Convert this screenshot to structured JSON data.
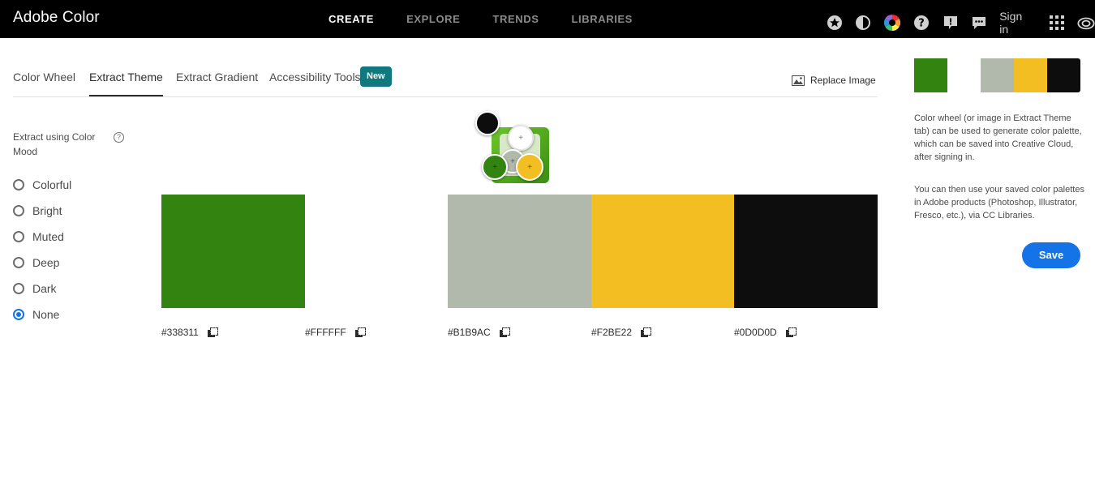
{
  "app": {
    "title": "Adobe Color"
  },
  "topnav": [
    "CREATE",
    "EXPLORE",
    "TRENDS",
    "LIBRARIES"
  ],
  "topnav_active": "CREATE",
  "header_icons": [
    "star-icon",
    "contrast-icon",
    "color-wheel-icon",
    "help-icon",
    "feedback-icon",
    "chat-icon"
  ],
  "signin_label": "Sign in",
  "tabs": [
    "Color Wheel",
    "Extract Theme",
    "Extract Gradient",
    "Accessibility Tools"
  ],
  "tabs_active": "Extract Theme",
  "new_badge": "New",
  "replace_image_label": "Replace Image",
  "mood": {
    "title": "Extract using Color Mood",
    "help": "?",
    "options": [
      "Colorful",
      "Bright",
      "Muted",
      "Deep",
      "Dark",
      "None"
    ],
    "selected": "None"
  },
  "swatches": [
    {
      "hex": "#338311",
      "color": "#338311"
    },
    {
      "hex": "#FFFFFF",
      "color": "#FFFFFF"
    },
    {
      "hex": "#B1B9AC",
      "color": "#B1B9AC"
    },
    {
      "hex": "#F2BE22",
      "color": "#F2BE22"
    },
    {
      "hex": "#0D0D0D",
      "color": "#0D0D0D"
    }
  ],
  "info": {
    "p1": "Color wheel (or image in Extract Theme tab) can be used to generate color palette, which can be saved into Creative Cloud, after signing in.",
    "p2": "You can then use your saved color palettes in Adobe products (Photoshop, Illustrator, Fresco, etc.), via CC Libraries."
  },
  "save_label": "Save"
}
